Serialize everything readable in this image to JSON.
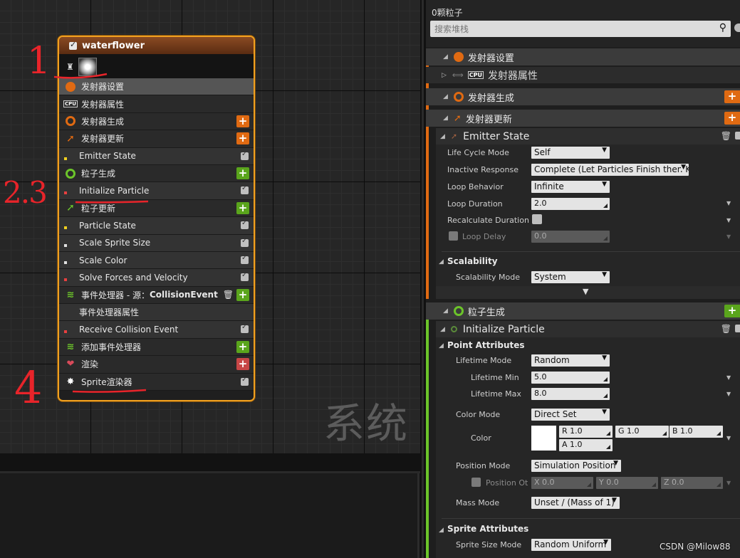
{
  "graph": {
    "watermark": "系统",
    "node": {
      "title": "waterflower",
      "rows": [
        {
          "kind": "section",
          "label": "发射器设置",
          "icon": "emitter-settings-icon",
          "action": "none",
          "highlight": true
        },
        {
          "kind": "section",
          "label": "发射器属性",
          "icon": "cpu-icon",
          "action": "none"
        },
        {
          "kind": "section",
          "label": "发射器生成",
          "icon": "emitter-spawn-icon",
          "action": "plus-orange"
        },
        {
          "kind": "section",
          "label": "发射器更新",
          "icon": "emitter-update-icon",
          "action": "plus-orange"
        },
        {
          "kind": "module",
          "label": "Emitter State",
          "action": "check"
        },
        {
          "kind": "section",
          "label": "粒子生成",
          "icon": "particle-spawn-icon",
          "action": "plus-green"
        },
        {
          "kind": "module",
          "label": "Initialize Particle",
          "action": "check"
        },
        {
          "kind": "section",
          "label": "粒子更新",
          "icon": "particle-update-icon",
          "action": "plus-green"
        },
        {
          "kind": "module",
          "label": "Particle State",
          "action": "check"
        },
        {
          "kind": "module",
          "label": "Scale Sprite Size",
          "action": "check"
        },
        {
          "kind": "module",
          "label": "Scale Color",
          "action": "check"
        },
        {
          "kind": "module",
          "label": "Solve Forces and Velocity",
          "action": "check"
        },
        {
          "kind": "section",
          "label": "事件处理器 - 源：",
          "label_bold": "CollisionEvent",
          "icon": "event-handler-icon",
          "action": "trash-plus"
        },
        {
          "kind": "module",
          "label": "事件处理器属性",
          "action": "none"
        },
        {
          "kind": "module",
          "label": "Receive Collision Event",
          "action": "check"
        },
        {
          "kind": "section",
          "label": "添加事件处理器",
          "icon": "event-handler-icon",
          "action": "plus-green"
        },
        {
          "kind": "section",
          "label": "渲染",
          "icon": "render-icon",
          "action": "plus-red"
        },
        {
          "kind": "section",
          "label": "Sprite渲染器",
          "icon": "sprite-renderer-icon",
          "action": "check"
        }
      ]
    },
    "annotations": [
      "1",
      "2.3",
      "4"
    ]
  },
  "panel": {
    "particle_count": "0颗粒子",
    "search_placeholder": "搜索堆栈",
    "sections": {
      "emitter_settings": "发射器设置",
      "emitter_properties": "发射器属性",
      "emitter_spawn": "发射器生成",
      "emitter_update": "发射器更新",
      "particle_spawn": "粒子生成"
    },
    "emitter_state": {
      "title": "Emitter State",
      "life_cycle_mode": {
        "label": "Life Cycle Mode",
        "value": "Self"
      },
      "inactive_response": {
        "label": "Inactive Response",
        "value": "Complete (Let Particles Finish then K"
      },
      "loop_behavior": {
        "label": "Loop Behavior",
        "value": "Infinite"
      },
      "loop_duration": {
        "label": "Loop Duration",
        "value": "2.0"
      },
      "recalculate_duration": {
        "label": "Recalculate Duration"
      },
      "loop_delay": {
        "label": "Loop Delay",
        "value": "0.0"
      },
      "scalability": "Scalability",
      "scalability_mode": {
        "label": "Scalability Mode",
        "value": "System"
      }
    },
    "initialize_particle": {
      "title": "Initialize Particle",
      "point_attributes": "Point Attributes",
      "lifetime_mode": {
        "label": "Lifetime Mode",
        "value": "Random"
      },
      "lifetime_min": {
        "label": "Lifetime Min",
        "value": "5.0"
      },
      "lifetime_max": {
        "label": "Lifetime Max",
        "value": "8.0"
      },
      "color_mode": {
        "label": "Color Mode",
        "value": "Direct Set"
      },
      "color": {
        "label": "Color",
        "r": "R 1.0",
        "g": "G 1.0",
        "b": "B 1.0",
        "a": "A 1.0"
      },
      "position_mode": {
        "label": "Position Mode",
        "value": "Simulation Position"
      },
      "position_offset": {
        "label": "Position Ot",
        "x": "X 0.0",
        "y": "Y 0.0",
        "z": "Z 0.0"
      },
      "mass_mode": {
        "label": "Mass Mode",
        "value": "Unset / (Mass of 1)"
      },
      "sprite_attributes": "Sprite Attributes",
      "sprite_size_mode": {
        "label": "Sprite Size Mode",
        "value": "Random Uniform"
      }
    },
    "watermark": "CSDN @Milow88"
  },
  "colors": {
    "node_border": "#f0a020",
    "emitter_stripe": "#e06a12",
    "particle_stripe": "#6cc42a",
    "plus_orange": "#e06a12",
    "plus_green": "#5aa51c",
    "plus_red": "#c74646",
    "annotation": "#e8242a"
  }
}
